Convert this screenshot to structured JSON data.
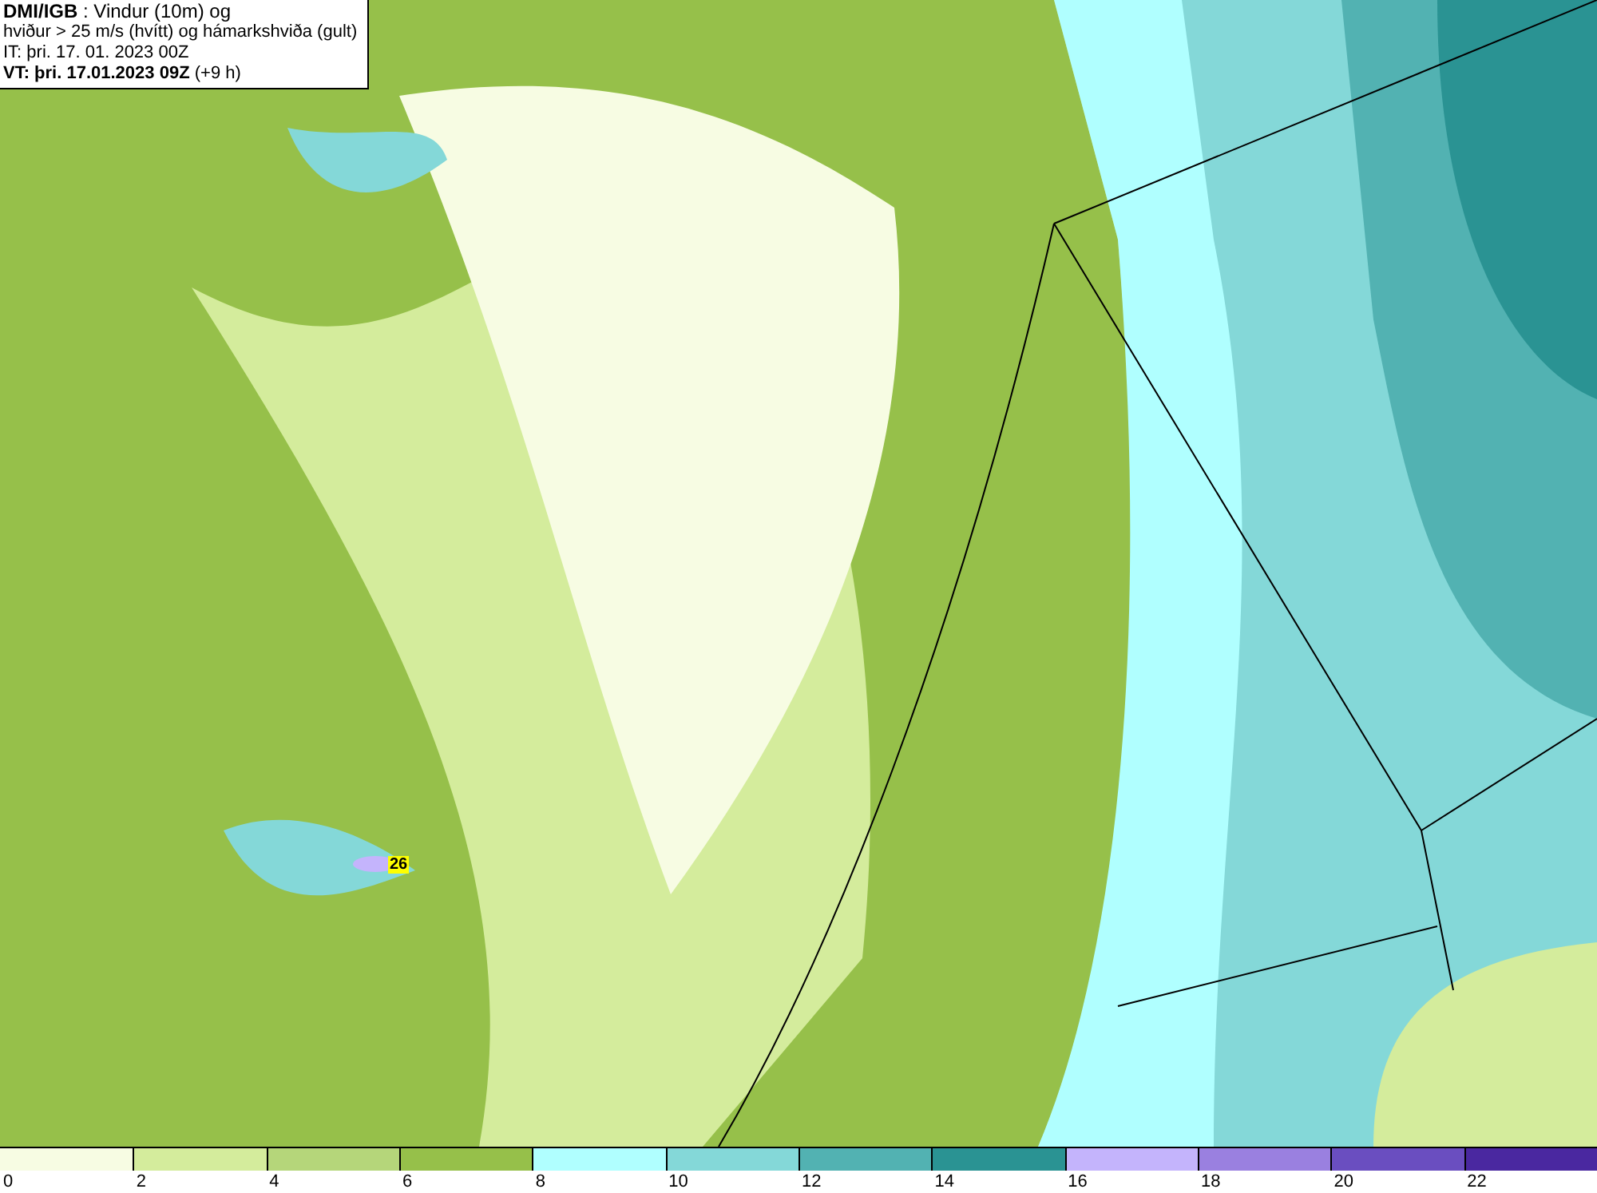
{
  "header": {
    "line1": "**DMI/IGB** : Vindur (10m) og",
    "line2": "hviður > 25 m/s (hvítt) og hámarkshviða (gult)",
    "line3": "IT: þri. 17. 01. 2023 00Z",
    "line4": "**VT: þri. 17.01.2023 09Z** (+9 h)"
  },
  "gust_marker": {
    "value": "26"
  },
  "legend": [
    {
      "label": "0",
      "color": "#f7fce3"
    },
    {
      "label": "2",
      "color": "#d4ec9c"
    },
    {
      "label": "4",
      "color": "#b5d67a"
    },
    {
      "label": "6",
      "color": "#96c04a"
    },
    {
      "label": "8",
      "color": "#b0ffff"
    },
    {
      "label": "10",
      "color": "#84d8d8"
    },
    {
      "label": "12",
      "color": "#52b2b2"
    },
    {
      "label": "14",
      "color": "#2a9393"
    },
    {
      "label": "16",
      "color": "#c4b4fc"
    },
    {
      "label": "18",
      "color": "#9a80e0"
    },
    {
      "label": "20",
      "color": "#6a4ec0"
    },
    {
      "label": "22",
      "color": "#4a28a0"
    }
  ]
}
